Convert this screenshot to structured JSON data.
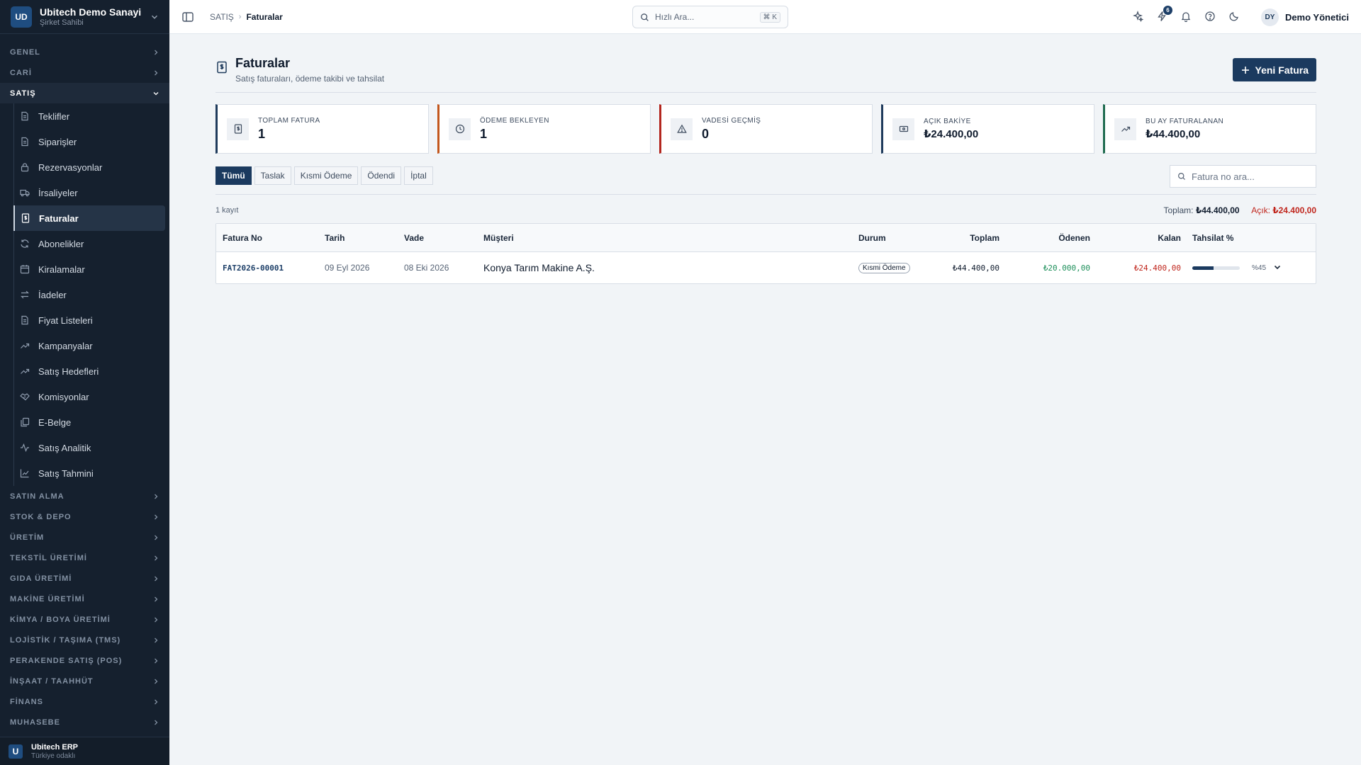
{
  "sidebar": {
    "logo": "UD",
    "org_name": "Ubitech Demo Sanayi",
    "org_role": "Şirket Sahibi",
    "groups_top": [
      {
        "label": "GENEL"
      },
      {
        "label": "CARİ"
      }
    ],
    "active_group": "SATIŞ",
    "items": [
      {
        "label": "Teklifler",
        "icon": "document-icon"
      },
      {
        "label": "Siparişler",
        "icon": "document-icon"
      },
      {
        "label": "Rezervasyonlar",
        "icon": "lock-icon"
      },
      {
        "label": "İrsaliyeler",
        "icon": "truck-icon"
      },
      {
        "label": "Faturalar",
        "icon": "invoice-icon",
        "active": true
      },
      {
        "label": "Abonelikler",
        "icon": "refresh-icon"
      },
      {
        "label": "Kiralamalar",
        "icon": "calendar-icon"
      },
      {
        "label": "İadeler",
        "icon": "swap-icon"
      },
      {
        "label": "Fiyat Listeleri",
        "icon": "document-icon"
      },
      {
        "label": "Kampanyalar",
        "icon": "trending-up-icon"
      },
      {
        "label": "Satış Hedefleri",
        "icon": "trending-up-icon"
      },
      {
        "label": "Komisyonlar",
        "icon": "handshake-icon"
      },
      {
        "label": "E-Belge",
        "icon": "files-icon"
      },
      {
        "label": "Satış Analitik",
        "icon": "activity-icon"
      },
      {
        "label": "Satış Tahmini",
        "icon": "line-chart-icon"
      }
    ],
    "groups_bottom": [
      {
        "label": "SATIN ALMA"
      },
      {
        "label": "STOK & DEPO"
      },
      {
        "label": "ÜRETİM"
      },
      {
        "label": "TEKSTİL ÜRETİMİ"
      },
      {
        "label": "GIDA ÜRETİMİ"
      },
      {
        "label": "MAKİNE ÜRETİMİ"
      },
      {
        "label": "KİMYA / BOYA ÜRETİMİ"
      },
      {
        "label": "LOJİSTİK / TAŞIMA (TMS)"
      },
      {
        "label": "PERAKENDE SATIŞ (POS)"
      },
      {
        "label": "İNŞAAT / TAAHHÜT"
      },
      {
        "label": "FİNANS"
      },
      {
        "label": "MUHASEBE"
      }
    ],
    "footer_logo": "U",
    "footer_name": "Ubitech ERP",
    "footer_sub": "Türkiye odaklı"
  },
  "topbar": {
    "breadcrumb_parent": "SATIŞ",
    "breadcrumb_current": "Faturalar",
    "search_placeholder": "Hızlı Ara...",
    "search_shortcut": "⌘ K",
    "notification_count": "6",
    "user_initials": "DY",
    "user_name": "Demo Yönetici"
  },
  "page": {
    "title": "Faturalar",
    "subtitle": "Satış faturaları, ödeme takibi ve tahsilat",
    "new_button": "Yeni Fatura"
  },
  "stats": [
    {
      "label": "TOPLAM FATURA",
      "value": "1",
      "icon": "invoice-icon"
    },
    {
      "label": "ÖDEME BEKLEYEN",
      "value": "1",
      "icon": "clock-icon"
    },
    {
      "label": "VADESİ GEÇMİŞ",
      "value": "0",
      "icon": "warning-icon"
    },
    {
      "label": "AÇIK BAKİYE",
      "value": "₺24.400,00",
      "icon": "banknote-icon"
    },
    {
      "label": "BU AY FATURALANAN",
      "value": "₺44.400,00",
      "icon": "trending-up-icon"
    }
  ],
  "filters": {
    "tabs": [
      "Tümü",
      "Taslak",
      "Kısmi Ödeme",
      "Ödendi",
      "İptal"
    ],
    "active_tab": "Tümü",
    "search_placeholder": "Fatura no ara..."
  },
  "summary": {
    "record_count": "1 kayıt",
    "total_label": "Toplam:",
    "total_value": "₺44.400,00",
    "open_label": "Açık:",
    "open_value": "₺24.400,00"
  },
  "table": {
    "columns": [
      "Fatura No",
      "Tarih",
      "Vade",
      "Müşteri",
      "Durum",
      "Toplam",
      "Ödenen",
      "Kalan",
      "Tahsilat %"
    ],
    "rows": [
      {
        "invoice_no": "FAT2026-00001",
        "date": "09 Eyl 2026",
        "due": "08 Eki 2026",
        "customer": "Konya Tarım Makine A.Ş.",
        "status": "Kısmi Ödeme",
        "total": "₺44.400,00",
        "paid": "₺20.000,00",
        "remaining": "₺24.400,00",
        "collected_pct": 45,
        "collected_label": "%45"
      }
    ]
  },
  "colors": {
    "sidebar_bg": "#15202e",
    "accent": "#1b3a5f",
    "paid_green": "#1d8f5a",
    "open_red": "#c0261d"
  }
}
